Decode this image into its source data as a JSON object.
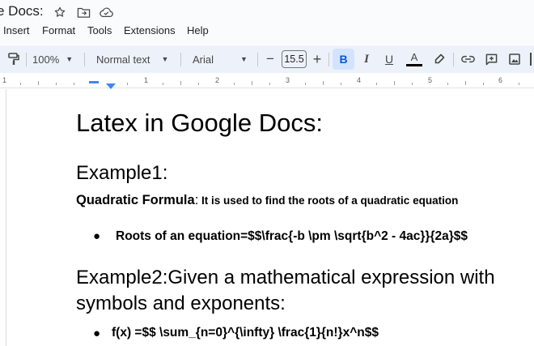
{
  "titlebar": {
    "doc_title": "e Docs:",
    "icons": [
      "star-icon",
      "move-to-folder-icon",
      "cloud-saved-icon"
    ]
  },
  "menu": {
    "items": [
      "Insert",
      "Format",
      "Tools",
      "Extensions",
      "Help"
    ]
  },
  "toolbar": {
    "zoom": "100%",
    "style": "Normal text",
    "font": "Arial",
    "font_size": "15.5",
    "decrease_symbol": "−",
    "increase_symbol": "+",
    "bold": "B",
    "italic": "I",
    "underline": "U",
    "text_color": "A",
    "text_color_value": "#000000",
    "accent_active": "#0b57d0"
  },
  "ruler": {
    "labels": [
      "1",
      "1",
      "2",
      "3",
      "4",
      "5",
      "6"
    ]
  },
  "document": {
    "title": "Latex in Google Docs:",
    "example1_heading": "Example1:",
    "quadratic_label": "Quadratic Formula",
    "quadratic_colon": ":",
    "quadratic_desc": " It is used to find the roots of a quadratic equation",
    "bullet1": "Roots of an equation=$$\\frac{-b \\pm \\sqrt{b^2 - 4ac}}{2a}$$",
    "example2_line1": "Example2:Given a mathematical expression with",
    "example2_line2": "symbols and exponents:",
    "bullet2": "f(x) =$$ \\sum_{n=0}^{\\infty} \\frac{1}{n!}x^n$$"
  }
}
